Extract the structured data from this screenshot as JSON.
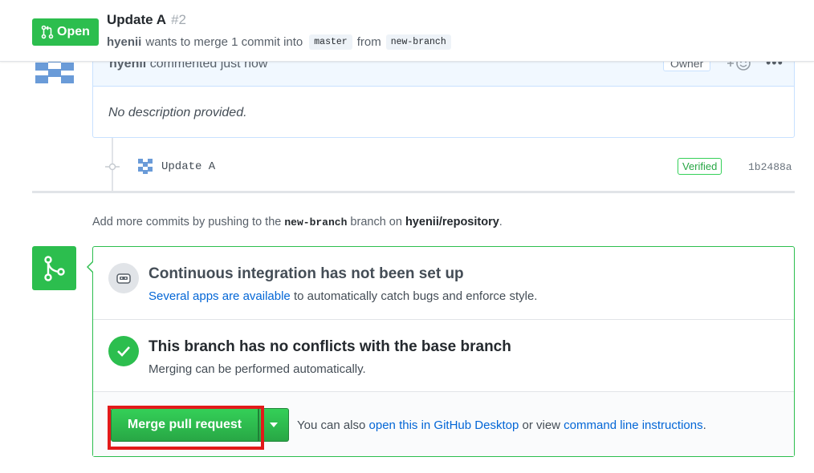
{
  "header": {
    "state_label": "Open",
    "title": "Update A",
    "number": "#2",
    "author": "hyenii",
    "meta_text": "wants to merge 1 commit into",
    "base_branch": "master",
    "from_text": "from",
    "head_branch": "new-branch"
  },
  "comment": {
    "author": "hyenii",
    "action_text": "commented just now",
    "owner_label": "Owner",
    "body": "No description provided."
  },
  "commit": {
    "message": "Update A",
    "verified_label": "Verified",
    "sha": "1b2488a"
  },
  "push_hint": {
    "prefix": "Add more commits by pushing to the",
    "branch": "new-branch",
    "middle": "branch on",
    "repo": "hyenii/repository",
    "suffix": "."
  },
  "merge": {
    "ci_heading": "Continuous integration has not been set up",
    "ci_link": "Several apps are available",
    "ci_sub": "to automatically catch bugs and enforce style.",
    "conflict_heading": "This branch has no conflicts with the base branch",
    "conflict_sub": "Merging can be performed automatically.",
    "merge_button": "Merge pull request",
    "hint_prefix": "You can also",
    "hint_link1": "open this in GitHub Desktop",
    "hint_middle": "or view",
    "hint_link2": "command line instructions",
    "hint_suffix": "."
  },
  "colors": {
    "success": "#2cbe4e",
    "link": "#0366d6",
    "highlight": "#e21a1a"
  }
}
